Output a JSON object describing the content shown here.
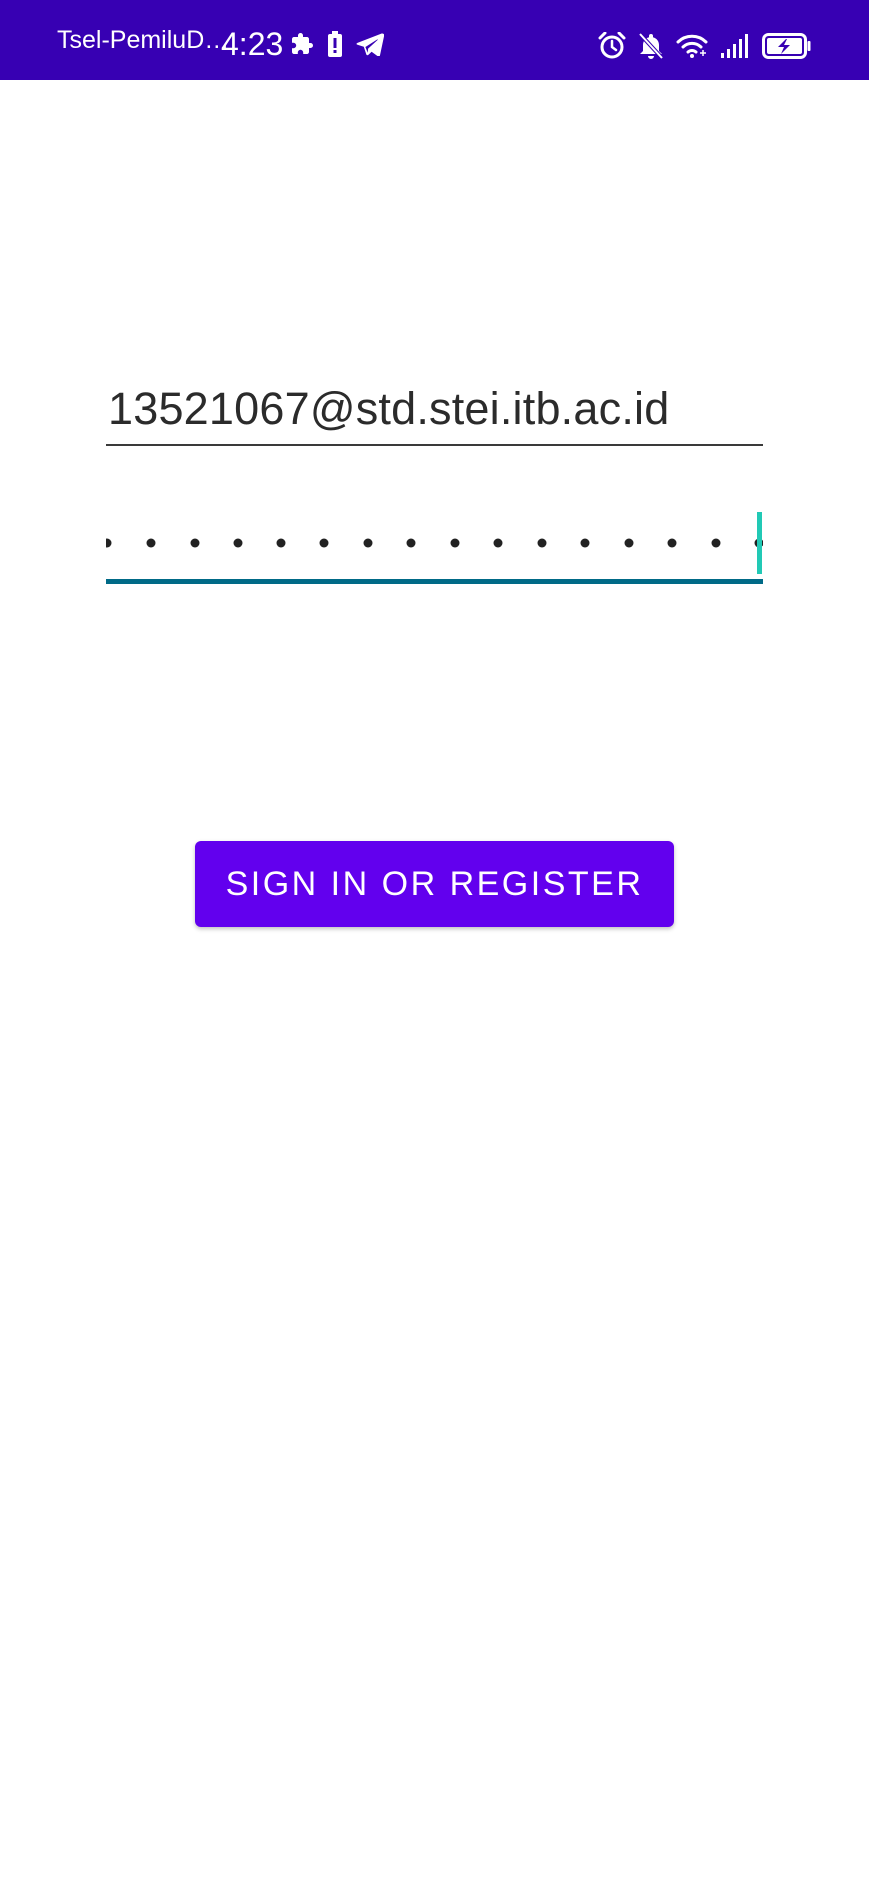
{
  "status_bar": {
    "background": "#3700b3",
    "carrier": "Tsel-PemiluD…",
    "time": "4:23",
    "left_icons": [
      "puzzle-icon",
      "battery-alert-icon",
      "telegram-icon"
    ],
    "right_icons": [
      "alarm-icon",
      "bell-off-icon",
      "wifi-icon",
      "signal-icon",
      "battery-charging-icon"
    ]
  },
  "form": {
    "email_value": "13521067@std.stei.itb.ac.id",
    "password_focus_color": "#006a87",
    "cursor_color": "#21c9b5"
  },
  "signin_button": {
    "label": "SIGN IN OR REGISTER",
    "color": "#6200ee"
  }
}
